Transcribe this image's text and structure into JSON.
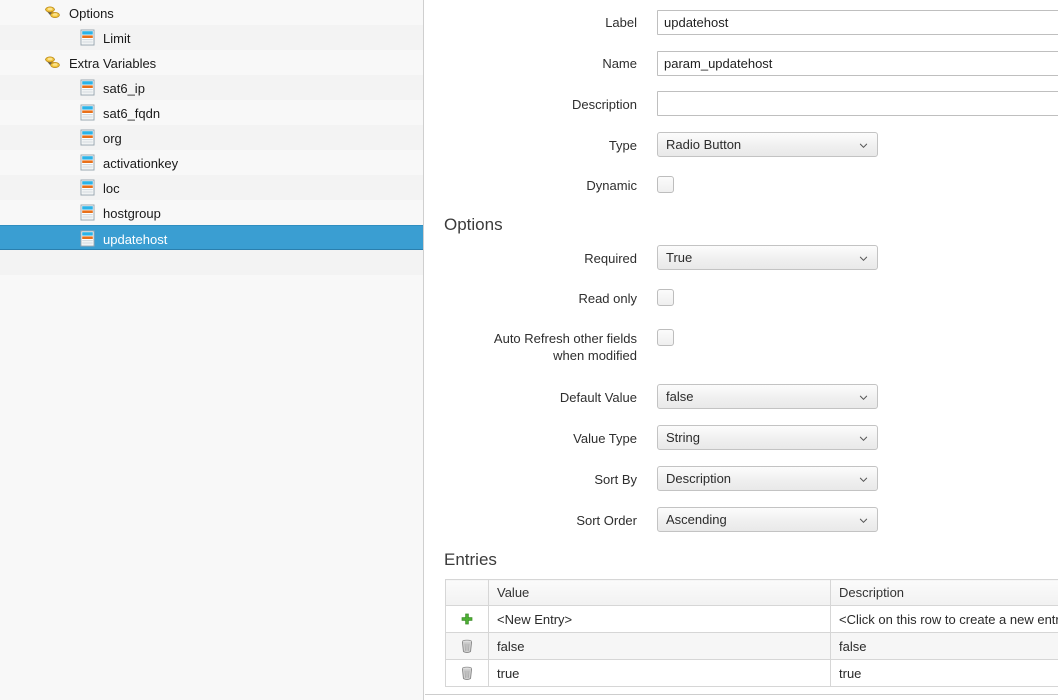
{
  "tree": {
    "rows": [
      {
        "label": "Options",
        "icon": "variable-group-icon",
        "level": 1,
        "expanded": true,
        "twisty": true,
        "selected": false
      },
      {
        "label": "Limit",
        "icon": "variable-icon",
        "level": 2,
        "expanded": null,
        "twisty": false,
        "selected": false
      },
      {
        "label": "Extra Variables",
        "icon": "variable-group-icon",
        "level": 1,
        "expanded": true,
        "twisty": true,
        "selected": false
      },
      {
        "label": "sat6_ip",
        "icon": "variable-icon",
        "level": 2,
        "expanded": null,
        "twisty": false,
        "selected": false
      },
      {
        "label": "sat6_fqdn",
        "icon": "variable-icon",
        "level": 2,
        "expanded": null,
        "twisty": false,
        "selected": false
      },
      {
        "label": "org",
        "icon": "variable-icon",
        "level": 2,
        "expanded": null,
        "twisty": false,
        "selected": false
      },
      {
        "label": "activationkey",
        "icon": "variable-icon",
        "level": 2,
        "expanded": null,
        "twisty": false,
        "selected": false
      },
      {
        "label": "loc",
        "icon": "variable-icon",
        "level": 2,
        "expanded": null,
        "twisty": false,
        "selected": false
      },
      {
        "label": "hostgroup",
        "icon": "variable-icon",
        "level": 2,
        "expanded": null,
        "twisty": false,
        "selected": false
      },
      {
        "label": "updatehost",
        "icon": "variable-icon",
        "level": 2,
        "expanded": null,
        "twisty": false,
        "selected": true
      }
    ],
    "selection_color": "#3a9ed2",
    "background_color": "#f8f8f8"
  },
  "form": {
    "label_field": {
      "label": "Label",
      "value": "updatehost",
      "placeholder": ""
    },
    "name_field": {
      "label": "Name",
      "value": "param_updatehost",
      "placeholder": ""
    },
    "description_field": {
      "label": "Description",
      "value": "",
      "placeholder": ""
    },
    "type_field": {
      "label": "Type",
      "value": "Radio Button"
    },
    "dynamic_field": {
      "label": "Dynamic",
      "checked": false
    }
  },
  "options_section": {
    "heading": "Options",
    "required_field": {
      "label": "Required",
      "value": "True"
    },
    "readonly_field": {
      "label": "Read only",
      "checked": false
    },
    "autorefresh_field": {
      "label_line1": "Auto Refresh other fields",
      "label_line2": "when modified",
      "checked": false
    },
    "default_value_field": {
      "label": "Default Value",
      "value": "false"
    },
    "value_type_field": {
      "label": "Value Type",
      "value": "String"
    },
    "sort_by_field": {
      "label": "Sort By",
      "value": "Description"
    },
    "sort_order_field": {
      "label": "Sort Order",
      "value": "Ascending"
    }
  },
  "entries_section": {
    "heading": "Entries",
    "columns": [
      "",
      "Value",
      "Description"
    ],
    "rows": [
      {
        "icon": "add-icon",
        "value": "<New Entry>",
        "description": "<Click on this row to create a new entry>"
      },
      {
        "icon": "delete-icon",
        "value": "false",
        "description": "false"
      },
      {
        "icon": "delete-icon",
        "value": "true",
        "description": "true"
      }
    ]
  }
}
